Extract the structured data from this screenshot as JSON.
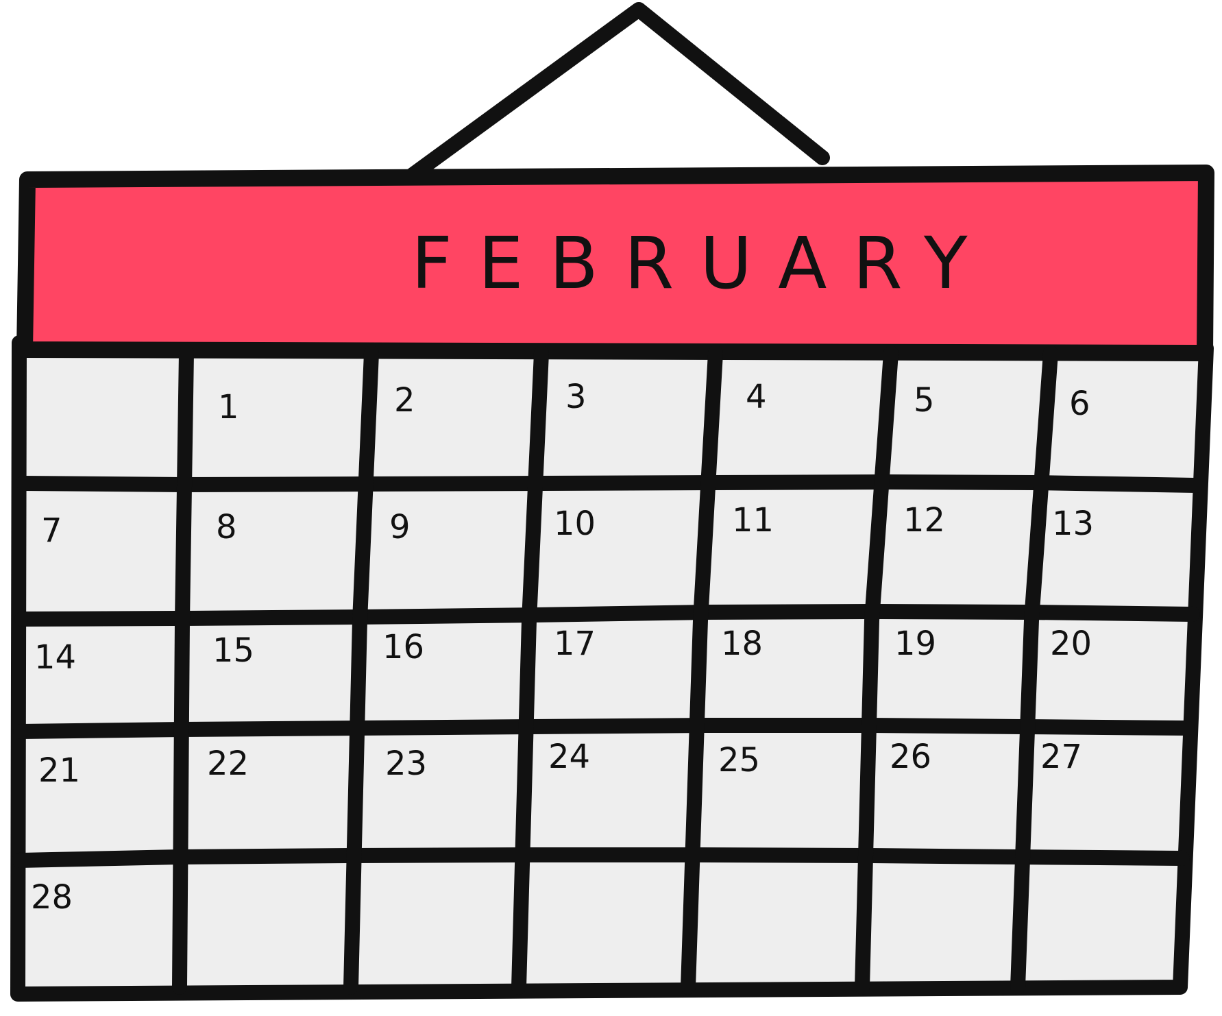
{
  "calendar": {
    "month": "FEBRUARY",
    "days": [
      "",
      "1",
      "2",
      "3",
      "4",
      "5",
      "6",
      "7",
      "8",
      "9",
      "10",
      "11",
      "12",
      "13",
      "14",
      "15",
      "16",
      "17",
      "18",
      "19",
      "20",
      "21",
      "22",
      "23",
      "24",
      "25",
      "26",
      "27",
      "28",
      "",
      "",
      "",
      "",
      "",
      ""
    ],
    "colors": {
      "header": "#ff4563",
      "cell": "#eeeeee",
      "ink": "#111111"
    }
  }
}
